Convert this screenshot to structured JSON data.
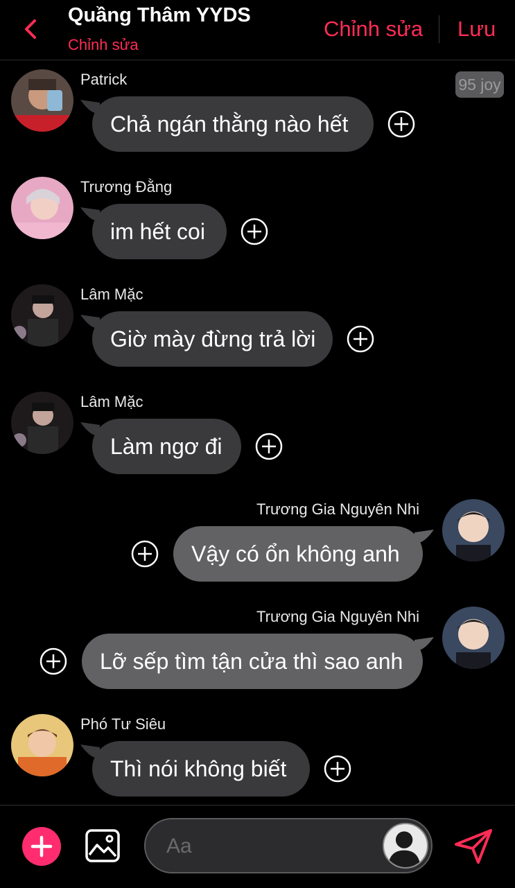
{
  "header": {
    "title": "Quầng Thâm YYDS",
    "subtitle": "Chỉnh sửa",
    "edit_label": "Chỉnh sửa",
    "save_label": "Lưu",
    "accent_color": "#ff2d55"
  },
  "badge": {
    "text": "95 joy"
  },
  "messages": [
    {
      "sender": "Patrick",
      "text": "Chả ngán thằng nào hết",
      "direction": "incoming"
    },
    {
      "sender": "Trương Đằng",
      "text": "im hết coi",
      "direction": "incoming"
    },
    {
      "sender": "Lâm Mặc",
      "text": "Giờ mày đừng trả lời",
      "direction": "incoming"
    },
    {
      "sender": "Lâm Mặc",
      "text": "Làm ngơ đi",
      "direction": "incoming"
    },
    {
      "sender": "Trương Gia Nguyên Nhi",
      "text": "Vậy có ổn không anh",
      "direction": "outgoing"
    },
    {
      "sender": "Trương Gia Nguyên Nhi",
      "text": "Lỡ sếp tìm tận cửa thì sao anh",
      "direction": "outgoing"
    },
    {
      "sender": "Phó Tư Siêu",
      "text": "Thì nói không biết",
      "direction": "incoming"
    }
  ],
  "composer": {
    "placeholder": "Aa",
    "icons": [
      "plus-icon",
      "image-icon",
      "avatar-icon",
      "send-icon"
    ]
  }
}
